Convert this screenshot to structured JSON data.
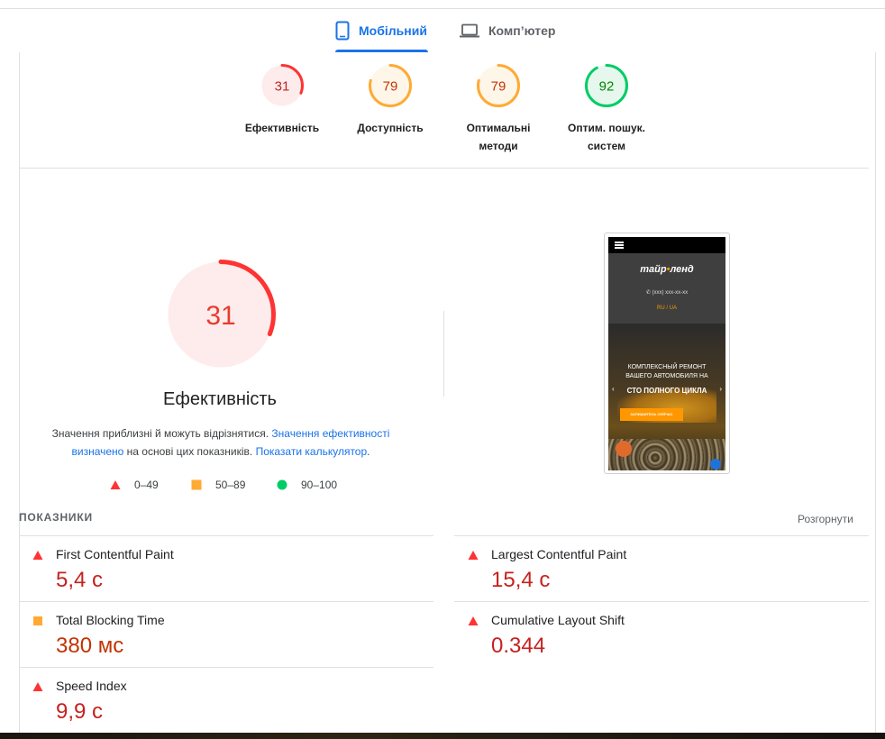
{
  "tabs": {
    "mobile_label": "Мобільний",
    "desktop_label": "Комп’ютер"
  },
  "summary_gauges": [
    {
      "score": "31",
      "label_line1": "Ефективність",
      "label_line2": "",
      "level": "fail",
      "fraction": 0.31
    },
    {
      "score": "79",
      "label_line1": "Доступність",
      "label_line2": "",
      "level": "average",
      "fraction": 0.79
    },
    {
      "score": "79",
      "label_line1": "Оптимальні",
      "label_line2": "методи",
      "level": "average",
      "fraction": 0.79
    },
    {
      "score": "92",
      "label_line1": "Оптим. пошук.",
      "label_line2": "систем",
      "level": "pass",
      "fraction": 0.92
    }
  ],
  "performance": {
    "score": "31",
    "fraction": 0.31,
    "title": "Ефективність",
    "note_prefix": "Значення приблизні й можуть відрізнятися. ",
    "note_link1": "Значення ефективності визначено",
    "note_mid": " на основі цих показників. ",
    "note_link2": "Показати калькулятор",
    "note_end": "."
  },
  "legend": {
    "fail": "0–49",
    "average": "50–89",
    "pass": "90–100"
  },
  "screenshot": {
    "logo_left": "тайр",
    "logo_dot": "•",
    "logo_right": "ленд",
    "phone_text": "✆ (xxx) xxx-xx-xx",
    "lang_text": "RU / UA",
    "hero_line1": "КОМПЛЕКСНЫЙ РЕМОНТ",
    "hero_line2": "ВАШЕГО АВТОМОБИЛЯ НА",
    "hero_title": "СТО ПОЛНОГО ЦИКЛА",
    "hero_button": "ЗАПИШИТЕСЬ СЕЙЧАС",
    "arrow_left": "‹",
    "arrow_right": "›"
  },
  "metrics": {
    "header": "ПОКАЗНИКИ",
    "expand_label": "Розгорнути",
    "items": [
      {
        "name": "First Contentful Paint",
        "value": "5,4 с",
        "level": "fail"
      },
      {
        "name": "Largest Contentful Paint",
        "value": "15,4 с",
        "level": "fail"
      },
      {
        "name": "Total Blocking Time",
        "value": "380 мс",
        "level": "average"
      },
      {
        "name": "Cumulative Layout Shift",
        "value": "0.344",
        "level": "fail"
      },
      {
        "name": "Speed Index",
        "value": "9,9 с",
        "level": "fail"
      }
    ]
  },
  "colors": {
    "fail": "#ff3333",
    "fail_bg": "#fdeceb",
    "fail_text": "#c5221f",
    "average": "#ffaa33",
    "average_bg": "#fff6ea",
    "average_text": "#c33300",
    "pass": "#00cc66",
    "pass_bg": "#e6f8ee",
    "pass_text": "#008800",
    "accent": "#1a73e8"
  }
}
